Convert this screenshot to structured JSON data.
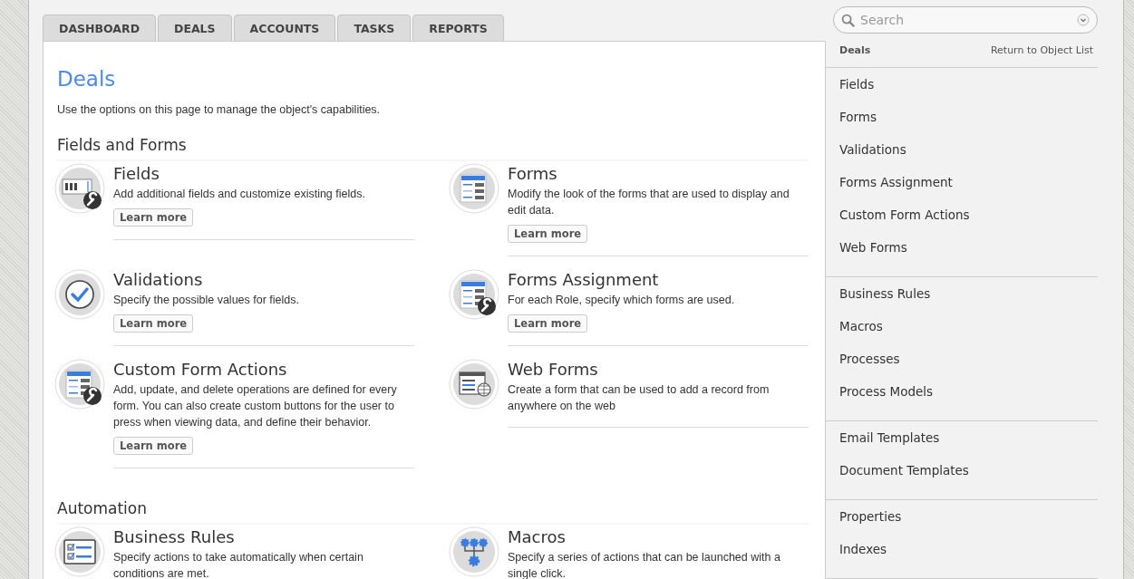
{
  "tabs": [
    {
      "label": "DASHBOARD",
      "selected": false
    },
    {
      "label": "DEALS",
      "selected": false
    },
    {
      "label": "ACCOUNTS",
      "selected": false
    },
    {
      "label": "TASKS",
      "selected": false
    },
    {
      "label": "REPORTS",
      "selected": false
    }
  ],
  "page": {
    "title": "Deals",
    "intro": "Use the options on this page to manage the object's capabilities."
  },
  "sections": [
    {
      "heading": "Fields and Forms",
      "cards": [
        {
          "kind": "abc-wrench",
          "title": "Fields",
          "description": "Add additional fields and customize existing fields.",
          "button": "Learn more"
        },
        {
          "kind": "form",
          "title": "Forms",
          "description": "Modify the look of the forms that are used to display and edit data.",
          "button": "Learn more"
        },
        {
          "kind": "check",
          "title": "Validations",
          "description": "Specify the possible values for fields.",
          "button": "Learn more"
        },
        {
          "kind": "form-wrench",
          "title": "Forms Assignment",
          "description": "For each Role, specify which forms are used.",
          "button": "Learn more"
        },
        {
          "kind": "form-wrench",
          "title": "Custom Form Actions",
          "description": "Add, update, and delete operations are defined for every form. You can also create custom buttons for the user to press when viewing data, and define their behavior.",
          "button": "Learn more"
        },
        {
          "kind": "web-form",
          "title": "Web Forms",
          "description": "Create a form that can be used to add a record from anywhere on the web"
        }
      ]
    },
    {
      "heading": "Automation",
      "cards": [
        {
          "kind": "checklist",
          "title": "Business Rules",
          "description": "Specify actions to take automatically when certain conditions are met."
        },
        {
          "kind": "gears",
          "title": "Macros",
          "description": "Specify a series of actions that can be launched with a single click."
        }
      ]
    }
  ],
  "sidebar": {
    "search": {
      "placeholder": "Search"
    },
    "object": "Deals",
    "return_link": "Return to Object List",
    "groups": [
      [
        "Fields",
        "Forms",
        "Validations",
        "Forms Assignment",
        "Custom Form Actions",
        "Web Forms"
      ],
      [
        "Business Rules",
        "Macros",
        "Processes",
        "Process Models"
      ],
      [
        "Email Templates",
        "Document Templates"
      ],
      [
        "Properties",
        "Indexes"
      ]
    ]
  }
}
